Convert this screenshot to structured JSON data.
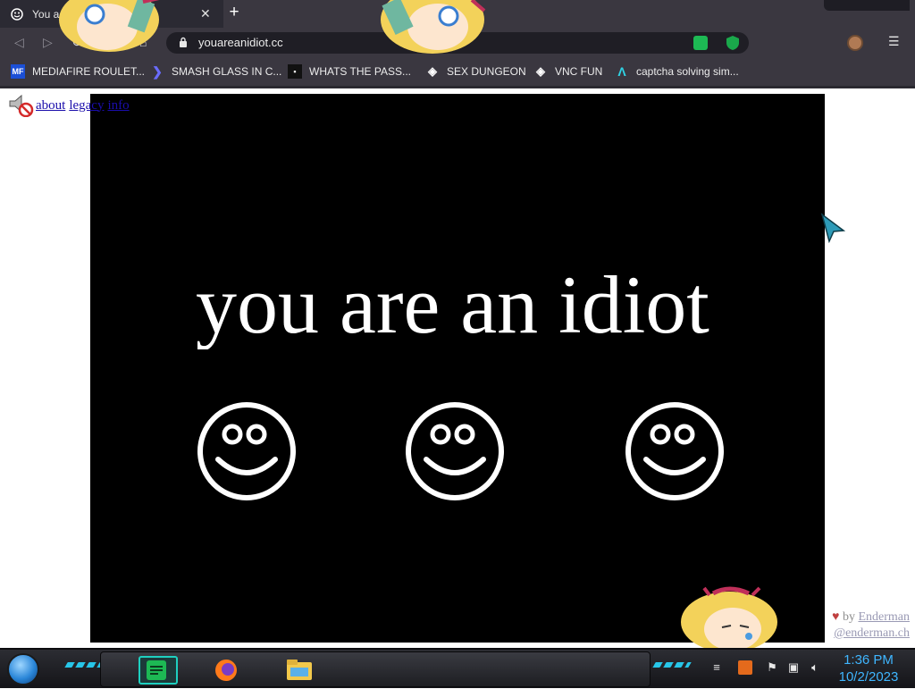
{
  "browser": {
    "tab_title": "You a",
    "url": "youareanidiot.cc",
    "bookmarks": [
      {
        "label": "MEDIAFIRE ROULET...",
        "icon": "mediafire-icon"
      },
      {
        "label": "SMASH GLASS IN C...",
        "icon": "chevron-bookmark-icon"
      },
      {
        "label": "WHATS THE PASS...",
        "icon": "terminal-bookmark-icon"
      },
      {
        "label": "SEX DUNGEON",
        "icon": "cube-bookmark-icon"
      },
      {
        "label": "VNC FUN",
        "icon": "cube-bookmark-icon"
      },
      {
        "label": "captcha solving sim...",
        "icon": "arrow-a-bookmark-icon"
      }
    ]
  },
  "page": {
    "links": [
      "about",
      "legacy",
      "info"
    ],
    "headline": "you are an idiot",
    "credit_by": "by",
    "credit_author": "Enderman",
    "credit_contact": "@enderman.ch"
  },
  "taskbar": {
    "time": "1:36 PM",
    "date": "10/2/2023"
  },
  "colors": {
    "stage": "#000000",
    "chrome": "#3a3740",
    "clock": "#3fb6ff",
    "accent": "#1ed0c0"
  }
}
